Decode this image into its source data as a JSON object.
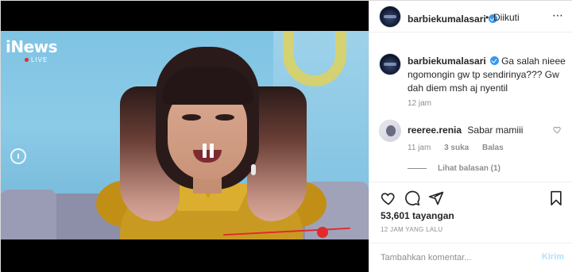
{
  "video": {
    "channel_logo": "iNews",
    "live_label": "LIVE",
    "controls": {
      "replay_icon": "replay-icon",
      "pause_icon": "pause-icon"
    }
  },
  "header": {
    "username": "barbiekumalasari",
    "verified_icon": "verified-badge-icon",
    "separator": "•",
    "follow_status": "Diikuti",
    "more_icon": "more-options-icon"
  },
  "caption": {
    "username": "barbiekumalasari",
    "text": "Ga salah nieee ngomongin gw tp sendirinya??? Gw dah diem msh aj nyentil",
    "time": "12 jam"
  },
  "comments": [
    {
      "username": "reeree.renia",
      "text": "Sabar mamiii",
      "time": "11 jam",
      "likes": "3 suka",
      "reply_label": "Balas",
      "view_replies": "Lihat balasan (1)"
    }
  ],
  "actions": {
    "like_icon": "heart-icon",
    "comment_icon": "comment-icon",
    "share_icon": "share-icon",
    "save_icon": "bookmark-icon"
  },
  "stats": {
    "views": "53,601 tayangan",
    "timestamp": "12 JAM YANG LALU"
  },
  "composer": {
    "placeholder": "Tambahkan komentar...",
    "post_label": "Kirim"
  },
  "colors": {
    "verified": "#3897f0",
    "muted_text": "#8e8e8e",
    "post_disabled": "#b2dffc",
    "live_dot": "#e32b2b"
  }
}
